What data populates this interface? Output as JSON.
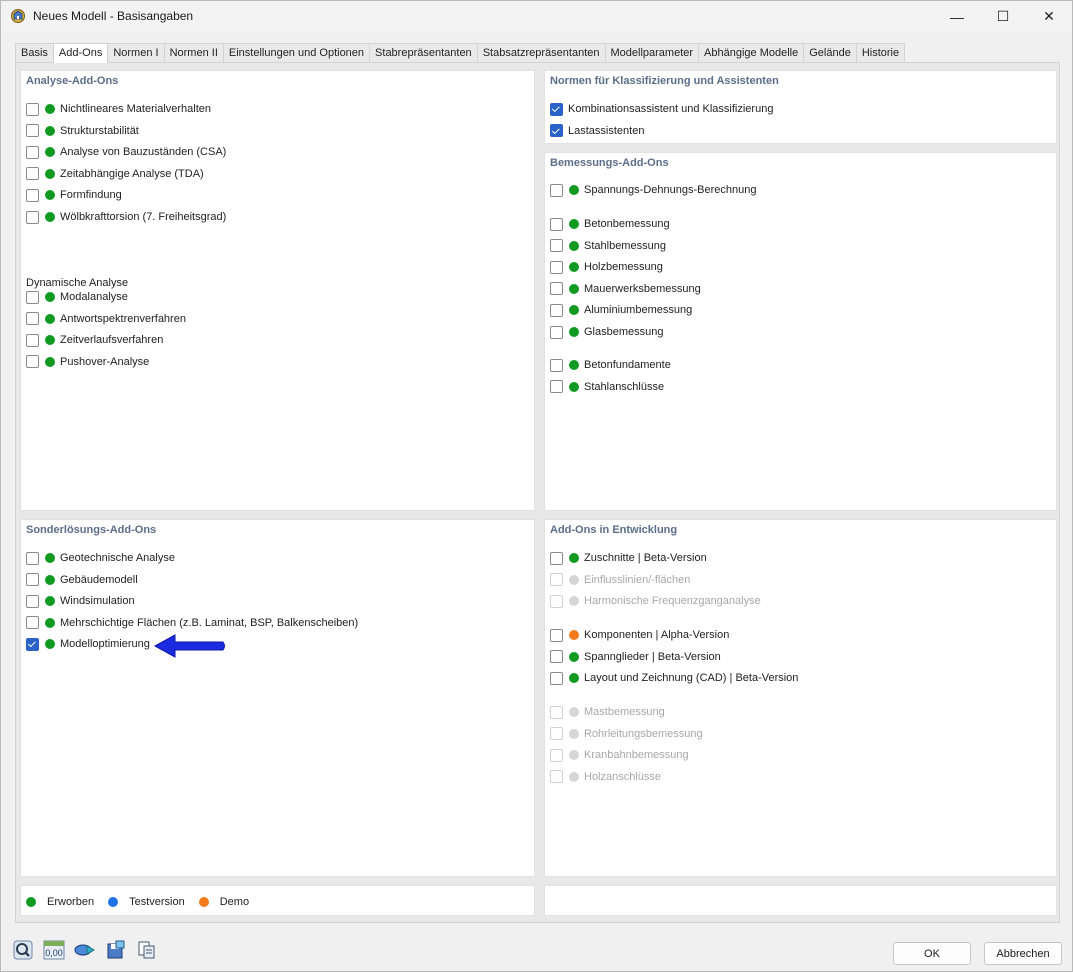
{
  "window": {
    "title": "Neues Modell - Basisangaben",
    "minimize_glyph": "—",
    "maximize_glyph": "☐",
    "close_glyph": "✕"
  },
  "tabs": [
    {
      "label": "Basis",
      "active": false
    },
    {
      "label": "Add-Ons",
      "active": true
    },
    {
      "label": "Normen I",
      "active": false
    },
    {
      "label": "Normen II",
      "active": false
    },
    {
      "label": "Einstellungen und Optionen",
      "active": false
    },
    {
      "label": "Stabrepräsentanten",
      "active": false
    },
    {
      "label": "Stabsatzrepräsentanten",
      "active": false
    },
    {
      "label": "Modellparameter",
      "active": false
    },
    {
      "label": "Abhängige Modelle",
      "active": false
    },
    {
      "label": "Gelände",
      "active": false
    },
    {
      "label": "Historie",
      "active": false
    }
  ],
  "colors": {
    "acquired": "#109a22",
    "trial": "#1f73e6",
    "demo": "#f27a1a",
    "disabled": "#d6d6d6",
    "accent": "#2a62c8",
    "panel_title": "#5a6e8a",
    "arrow": "#1a2be0"
  },
  "analysis": {
    "title": "Analyse-Add-Ons",
    "items": [
      {
        "label": "Nichtlineares Materialverhalten",
        "checked": false,
        "status": "acquired"
      },
      {
        "label": "Strukturstabilität",
        "checked": false,
        "status": "acquired"
      },
      {
        "label": "Analyse von Bauzuständen (CSA)",
        "checked": false,
        "status": "acquired"
      },
      {
        "label": "Zeitabhängige Analyse (TDA)",
        "checked": false,
        "status": "acquired"
      },
      {
        "label": "Formfindung",
        "checked": false,
        "status": "acquired"
      },
      {
        "label": "Wölbkrafttorsion (7. Freiheitsgrad)",
        "checked": false,
        "status": "acquired"
      }
    ],
    "dynamic_heading": "Dynamische Analyse",
    "dynamic_items": [
      {
        "label": "Modalanalyse",
        "checked": false,
        "status": "acquired"
      },
      {
        "label": "Antwortspektrenverfahren",
        "checked": false,
        "status": "acquired"
      },
      {
        "label": "Zeitverlaufsverfahren",
        "checked": false,
        "status": "acquired"
      },
      {
        "label": "Pushover-Analyse",
        "checked": false,
        "status": "acquired"
      }
    ]
  },
  "norms": {
    "title": "Normen für Klassifizierung und Assistenten",
    "items": [
      {
        "label": "Kombinationsassistent und Klassifizierung",
        "checked": true
      },
      {
        "label": "Lastassistenten",
        "checked": true
      }
    ]
  },
  "design": {
    "title": "Bemessungs-Add-Ons",
    "groups": [
      [
        {
          "label": "Spannungs-Dehnungs-Berechnung",
          "checked": false,
          "status": "acquired"
        }
      ],
      [
        {
          "label": "Betonbemessung",
          "checked": false,
          "status": "acquired"
        },
        {
          "label": "Stahlbemessung",
          "checked": false,
          "status": "acquired"
        },
        {
          "label": "Holzbemessung",
          "checked": false,
          "status": "acquired"
        },
        {
          "label": "Mauerwerksbemessung",
          "checked": false,
          "status": "acquired"
        },
        {
          "label": "Aluminiumbemessung",
          "checked": false,
          "status": "acquired"
        },
        {
          "label": "Glasbemessung",
          "checked": false,
          "status": "acquired"
        }
      ],
      [
        {
          "label": "Betonfundamente",
          "checked": false,
          "status": "acquired"
        },
        {
          "label": "Stahlanschlüsse",
          "checked": false,
          "status": "acquired"
        }
      ]
    ]
  },
  "special": {
    "title": "Sonderlösungs-Add-Ons",
    "items": [
      {
        "label": "Geotechnische Analyse",
        "checked": false,
        "status": "acquired"
      },
      {
        "label": "Gebäudemodell",
        "checked": false,
        "status": "acquired"
      },
      {
        "label": "Windsimulation",
        "checked": false,
        "status": "acquired"
      },
      {
        "label": "Mehrschichtige Flächen (z.B. Laminat, BSP, Balkenscheiben)",
        "checked": false,
        "status": "acquired"
      },
      {
        "label": "Modelloptimierung",
        "checked": true,
        "status": "acquired"
      }
    ]
  },
  "development": {
    "title": "Add-Ons in Entwicklung",
    "groups": [
      [
        {
          "label": "Zuschnitte | Beta-Version",
          "checked": false,
          "status": "acquired",
          "enabled": true
        },
        {
          "label": "Einflusslinien/-flächen",
          "checked": false,
          "status": "disabled",
          "enabled": false
        },
        {
          "label": "Harmonische Frequenzganganalyse",
          "checked": false,
          "status": "disabled",
          "enabled": false
        }
      ],
      [
        {
          "label": "Komponenten | Alpha-Version",
          "checked": false,
          "status": "demo",
          "enabled": true
        },
        {
          "label": "Spannglieder | Beta-Version",
          "checked": false,
          "status": "acquired",
          "enabled": true
        },
        {
          "label": "Layout und Zeichnung (CAD) | Beta-Version",
          "checked": false,
          "status": "acquired",
          "enabled": true
        }
      ],
      [
        {
          "label": "Mastbemessung",
          "checked": false,
          "status": "disabled",
          "enabled": false
        },
        {
          "label": "Rohrleitungsbemessung",
          "checked": false,
          "status": "disabled",
          "enabled": false
        },
        {
          "label": "Kranbahnbemessung",
          "checked": false,
          "status": "disabled",
          "enabled": false
        },
        {
          "label": "Holzanschlüsse",
          "checked": false,
          "status": "disabled",
          "enabled": false
        }
      ]
    ]
  },
  "legend": [
    {
      "label": "Erworben",
      "status": "acquired"
    },
    {
      "label": "Testversion",
      "status": "trial"
    },
    {
      "label": "Demo",
      "status": "demo"
    }
  ],
  "footer": {
    "icons": [
      "help-icon",
      "units-icon",
      "transfer-icon",
      "save-template-icon",
      "copy-icon"
    ],
    "units_text": "0,00",
    "ok_label": "OK",
    "cancel_label": "Abbrechen"
  }
}
